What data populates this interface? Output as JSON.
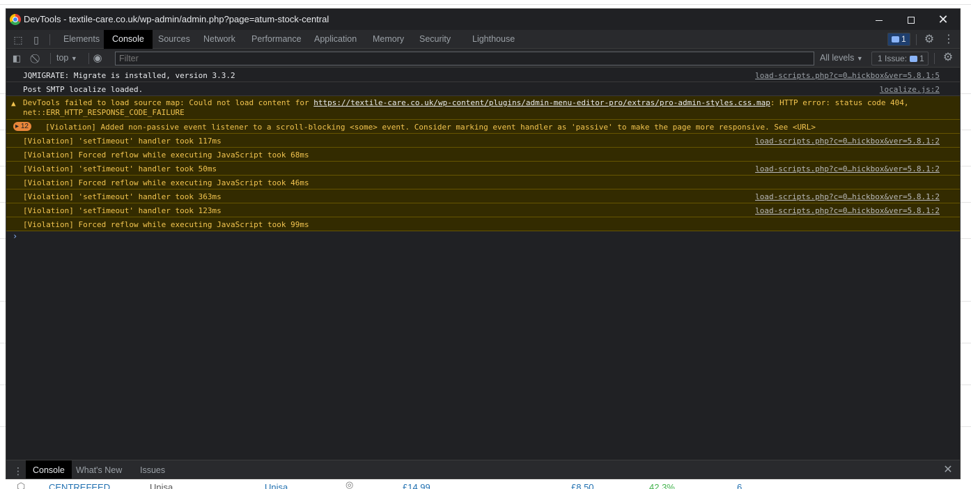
{
  "window": {
    "title": "DevTools - textile-care.co.uk/wp-admin/admin.php?page=atum-stock-central",
    "minimize_icon": "minimize-icon",
    "maximize_icon": "maximize-icon",
    "close_icon": "close-icon"
  },
  "tabs": [
    {
      "label": "Elements"
    },
    {
      "label": "Console",
      "active": true
    },
    {
      "label": "Sources"
    },
    {
      "label": "Network"
    },
    {
      "label": "Performance"
    },
    {
      "label": "Application"
    },
    {
      "label": "Memory"
    },
    {
      "label": "Security"
    },
    {
      "label": "Lighthouse"
    }
  ],
  "tabbar": {
    "messages_count": "1"
  },
  "console_toolbar": {
    "context": "top",
    "filter_placeholder": "Filter",
    "levels": "All levels",
    "issues_label": "1 Issue:",
    "issues_count": "1"
  },
  "messages": [
    {
      "text": "JQMIGRATE: Migrate is installed, version 3.3.2",
      "source": "load-scripts.php?c=0…hickbox&ver=5.8.1:5"
    },
    {
      "text": "Post SMTP localize loaded.",
      "source": "localize.js:2"
    },
    {
      "pre": "DevTools failed to load source map: Could not load content for ",
      "link": "https://textile-care.co.uk/wp-content/plugins/admin-menu-editor-pro/extras/pro-admin-styles.css.map",
      "post": ": HTTP error: status code 404, net::ERR_HTTP_RESPONSE_CODE_FAILURE"
    },
    {
      "count": "12",
      "text": "[Violation] Added non-passive event listener to a scroll-blocking <some> event. Consider marking event handler as 'passive' to make the page more responsive. See <URL>"
    },
    {
      "text": "[Violation] 'setTimeout' handler took 117ms",
      "source": "load-scripts.php?c=0…hickbox&ver=5.8.1:2"
    },
    {
      "text": "[Violation] Forced reflow while executing JavaScript took 68ms"
    },
    {
      "text": "[Violation] 'setTimeout' handler took 50ms",
      "source": "load-scripts.php?c=0…hickbox&ver=5.8.1:2"
    },
    {
      "text": "[Violation] Forced reflow while executing JavaScript took 46ms"
    },
    {
      "text": "[Violation] 'setTimeout' handler took 363ms",
      "source": "load-scripts.php?c=0…hickbox&ver=5.8.1:2"
    },
    {
      "text": "[Violation] 'setTimeout' handler took 123ms",
      "source": "load-scripts.php?c=0…hickbox&ver=5.8.1:2"
    },
    {
      "text": "[Violation] Forced reflow while executing JavaScript took 99ms"
    }
  ],
  "prompt": "›",
  "drawer": {
    "tabs": [
      {
        "label": "Console"
      },
      {
        "label": "What's New"
      },
      {
        "label": "Issues"
      }
    ]
  },
  "background_row": [
    "CENTREFEED",
    "Unisa",
    "Unisa",
    "£14.99",
    "£8.50",
    "42.3%",
    "6"
  ],
  "colors": {
    "panel_bg": "#202124",
    "toolbar_bg": "#292a2d",
    "warning_bg": "#332b00",
    "warning_text": "#f2c44f",
    "accent_blue": "#8ab4f8"
  }
}
